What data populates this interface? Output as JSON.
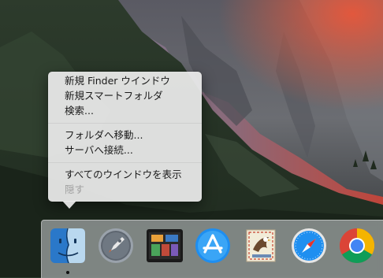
{
  "context_menu": {
    "items": [
      {
        "label": "新規 Finder ウインドウ",
        "enabled": true
      },
      {
        "label": "新規スマートフォルダ",
        "enabled": true
      },
      {
        "label": "検索...",
        "enabled": true
      },
      {
        "label": "フォルダへ移動...",
        "enabled": true
      },
      {
        "label": "サーバへ接続...",
        "enabled": true
      },
      {
        "label": "すべてのウインドウを表示",
        "enabled": true
      },
      {
        "label": "隠す",
        "enabled": false
      }
    ]
  },
  "dock": {
    "apps": [
      {
        "icon": "finder-icon",
        "running": true
      },
      {
        "icon": "launchpad-icon",
        "running": false
      },
      {
        "icon": "mission-control-icon",
        "running": false
      },
      {
        "icon": "app-store-icon",
        "running": false
      },
      {
        "icon": "mail-icon",
        "running": false
      },
      {
        "icon": "safari-icon",
        "running": false
      },
      {
        "icon": "chrome-icon",
        "running": false
      }
    ]
  },
  "colors": {
    "menu_background": "#ececec",
    "menu_text": "#1a1a1a",
    "menu_text_disabled": "#a0a0a0",
    "dock_background": "#d2d6d8"
  }
}
